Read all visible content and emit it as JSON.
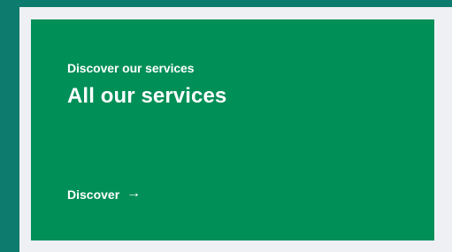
{
  "card": {
    "eyebrow": "Discover our services",
    "title": "All our services",
    "cta_label": "Discover",
    "cta_icon": "arrow-right-icon"
  },
  "colors": {
    "outer_background": "#0d7b6d",
    "frame_background": "#eef0f4",
    "card_background": "#008f57",
    "text": "#ffffff"
  }
}
